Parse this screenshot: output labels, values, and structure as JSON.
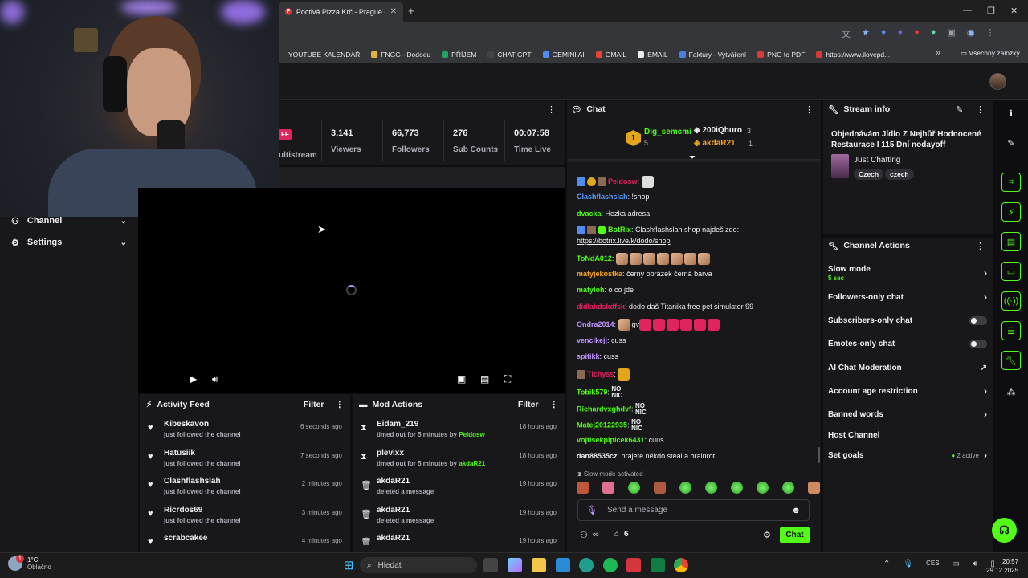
{
  "browser": {
    "tab_title": "Poctivá Pizza Krč - Prague - roz",
    "favicon_letter": "F",
    "tab_close": "✕",
    "new_tab": "+",
    "minimize": "—",
    "maximize": "❐",
    "close": "✕",
    "bookmarks": [
      {
        "label": "YOUTUBE KALENDÁŘ",
        "color": "#35363a"
      },
      {
        "label": "FNGG - Dodoeu",
        "color": "#e2b53b"
      },
      {
        "label": "PŘÍJEM",
        "color": "#1fa463"
      },
      {
        "label": "CHAT GPT",
        "color": "#444444"
      },
      {
        "label": "GEMINI AI",
        "color": "#4f8df5"
      },
      {
        "label": "GMAIL",
        "color": "#ea4335"
      },
      {
        "label": "EMAIL",
        "color": "#eeeeee"
      },
      {
        "label": "Faktury - Vytváření",
        "color": "#4e7fe0"
      },
      {
        "label": "PNG to PDF",
        "color": "#d83a3a"
      },
      {
        "label": "https://www.ilovepd...",
        "color": "#d83a3a"
      }
    ],
    "bookmarks_more": "»",
    "all_bookmarks": "Všechny záložky"
  },
  "sidebar": {
    "items": [
      {
        "label": "Channel",
        "icon": "users-icon"
      },
      {
        "label": "Settings",
        "icon": "gear-icon"
      }
    ]
  },
  "stats": {
    "multistream_badge": "FF",
    "multistream_label": "ultistream",
    "items": [
      {
        "value": "3,141",
        "label": "Viewers"
      },
      {
        "value": "66,773",
        "label": "Followers"
      },
      {
        "value": "276",
        "label": "Sub Counts"
      },
      {
        "value": "00:07:58",
        "label": "Time Live"
      }
    ]
  },
  "activity_feed": {
    "title": "Activity Feed",
    "filter": "Filter",
    "items": [
      {
        "name": "Kibeskavon",
        "text": "just followed the channel",
        "time": "6 seconds ago"
      },
      {
        "name": "Hatusiik",
        "text": "just followed the channel",
        "time": "7 seconds ago"
      },
      {
        "name": "Clashflashslah",
        "text": "just followed the channel",
        "time": "2 minutes ago"
      },
      {
        "name": "Ricrdos69",
        "text": "just followed the channel",
        "time": "3 minutes ago"
      },
      {
        "name": "scrabcakee",
        "text": "",
        "time": "4 minutes ago"
      }
    ]
  },
  "mod_actions": {
    "title": "Mod Actions",
    "filter": "Filter",
    "items": [
      {
        "name": "Eidam_219",
        "text": "timed out for 5 minutes by",
        "by": "Peldosw",
        "time": "18 hours ago",
        "icon": "hourglass-icon"
      },
      {
        "name": "plevixx",
        "text": "timed out for 5 minutes by",
        "by": "akdaR21",
        "time": "18 hours ago",
        "icon": "hourglass-icon"
      },
      {
        "name": "akdaR21",
        "text": "deleted a message",
        "by": "",
        "time": "19 hours ago",
        "icon": "trash-icon"
      },
      {
        "name": "akdaR21",
        "text": "deleted a message",
        "by": "",
        "time": "19 hours ago",
        "icon": "trash-icon"
      },
      {
        "name": "akdaR21",
        "text": "",
        "by": "",
        "time": "19 hours ago",
        "icon": "trash-icon"
      }
    ]
  },
  "chat": {
    "title": "Chat",
    "leaders": [
      {
        "rank": "1",
        "name": "Dig_semcmi",
        "count": "5"
      },
      {
        "rank": "",
        "name": "200iQhuro",
        "count": "3"
      },
      {
        "rank": "",
        "name": "akdaR21",
        "count": "1"
      }
    ],
    "messages": [
      {
        "user": "Peldosw",
        "color": "#e0245e",
        "text": ""
      },
      {
        "user": "Clashflashslah",
        "color": "#5c9dff",
        "text": "!shop"
      },
      {
        "user": "dvacka",
        "color": "#53fc18",
        "text": "Hezka adresa"
      },
      {
        "user": "BotRix",
        "color": "#53fc18",
        "text": "Clashflashslah shop najdeš zde:"
      },
      {
        "user": "",
        "color": "#efeff1",
        "text": "https://botrix.live/k/dodo/shop"
      },
      {
        "user": "ToNdA012",
        "color": "#53fc18",
        "text": ""
      },
      {
        "user": "matyjekostka",
        "color": "#f5a623",
        "text": "černý obrázek černá barva"
      },
      {
        "user": "matyloh",
        "color": "#53fc18",
        "text": "o co jde"
      },
      {
        "user": "didlakdskdfsk",
        "color": "#e0245e",
        "text": "dodo daš Titanika free pet simulator 99"
      },
      {
        "user": "Ondra2014",
        "color": "#bf94ff",
        "text": "gv"
      },
      {
        "user": "vencikejj",
        "color": "#bf94ff",
        "text": "cuss"
      },
      {
        "user": "spitikk",
        "color": "#bf94ff",
        "text": "cuss"
      },
      {
        "user": "Tichyss",
        "color": "#e0245e",
        "text": ""
      },
      {
        "user": "Tobik579",
        "color": "#53fc18",
        "text": "NO NIC"
      },
      {
        "user": "Richardvxghdvf",
        "color": "#53fc18",
        "text": "NO NIC"
      },
      {
        "user": "Matej20122935",
        "color": "#53fc18",
        "text": "NO NIC"
      },
      {
        "user": "vojtisekpipicek6431",
        "color": "#53fc18",
        "text": "cuus"
      },
      {
        "user": "dan88535cz",
        "color": "#efeff1",
        "text": "hrajete někdo steal a brainrot"
      }
    ],
    "slow_mode_note": "Slow mode activated",
    "placeholder": "Send a message",
    "infinity": "∞",
    "points": "6",
    "send_label": "Chat"
  },
  "stream_info": {
    "title": "Stream info",
    "stream_title": "Objednávám Jídlo Z Nejhůř Hodnocené Restaurace I 115 Dní nodayoff",
    "category": "Just Chatting",
    "tags": [
      "Czech",
      "czech"
    ]
  },
  "channel_actions": {
    "title": "Channel Actions",
    "slow_mode": "Slow mode",
    "slow_mode_value": "5 sec",
    "followers_only": "Followers-only chat",
    "subscribers_only": "Subscribers-only chat",
    "emotes_only": "Emotes-only chat",
    "ai_moderation": "AI Chat Moderation",
    "account_age": "Account age restriction",
    "banned_words": "Banned words",
    "host_channel": "Host Channel",
    "set_goals": "Set goals",
    "goals_active": "2 active"
  },
  "taskbar": {
    "weather_temp": "1°C",
    "weather_text": "Oblačno",
    "weather_badge": "1",
    "search_placeholder": "Hledat",
    "language": "CES",
    "time": "20:57",
    "date": "29.12.2025"
  },
  "colors": {
    "accent": "#53fc18",
    "bg": "#0e0e10",
    "panel": "#18181b"
  }
}
